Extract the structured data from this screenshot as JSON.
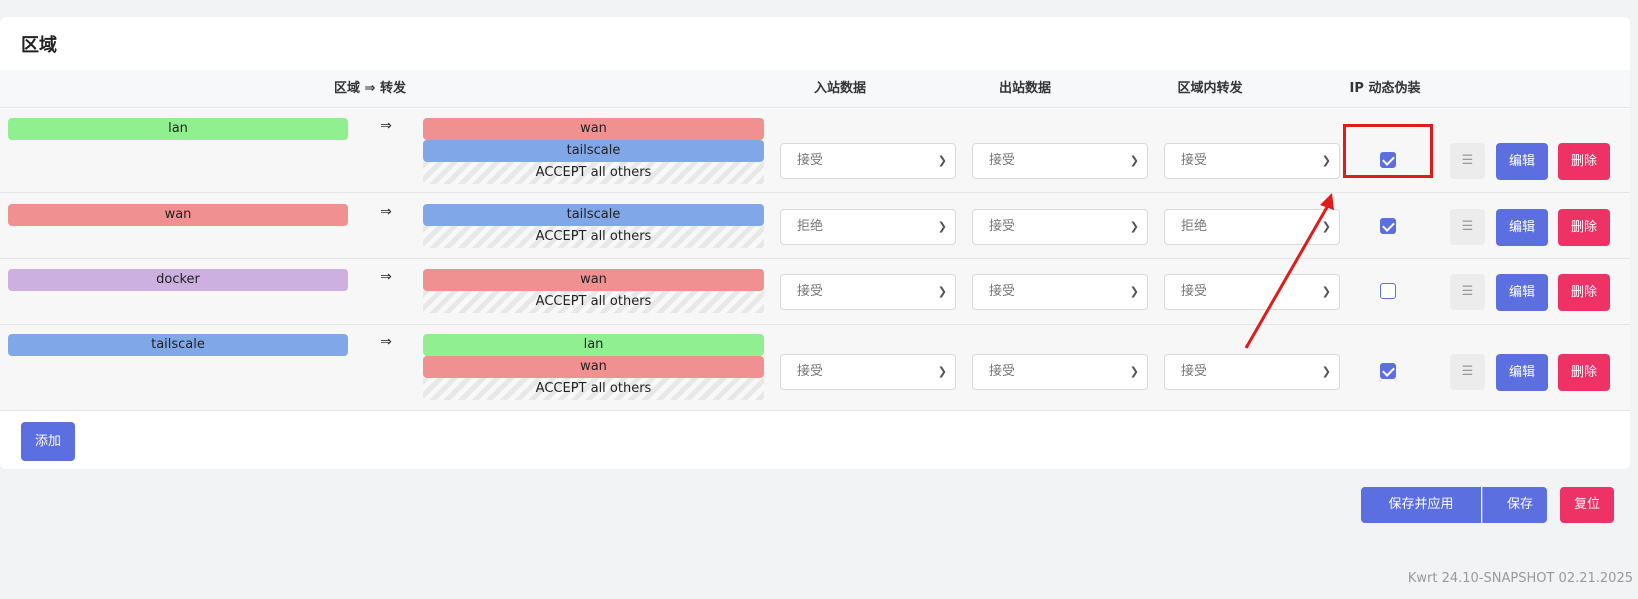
{
  "section": {
    "title": "区域"
  },
  "headers": {
    "zone_forward": "区域 ⇒ 转发",
    "inbound": "入站数据",
    "outbound": "出站数据",
    "intra_zone": "区域内转发",
    "masquerade": "IP 动态伪装"
  },
  "rows": [
    {
      "zone": "lan",
      "arrow": "⇒",
      "forwards": [
        "wan",
        "tailscale"
      ],
      "others": "ACCEPT all others",
      "inbound": "接受",
      "outbound": "接受",
      "intra": "接受",
      "masquerade": true,
      "handle": "☰",
      "edit": "编辑",
      "delete": "删除"
    },
    {
      "zone": "wan",
      "arrow": "⇒",
      "forwards": [
        "tailscale"
      ],
      "others": "ACCEPT all others",
      "inbound": "拒绝",
      "outbound": "接受",
      "intra": "拒绝",
      "masquerade": true,
      "handle": "☰",
      "edit": "编辑",
      "delete": "删除"
    },
    {
      "zone": "docker",
      "arrow": "⇒",
      "forwards": [
        "wan"
      ],
      "others": "ACCEPT all others",
      "inbound": "接受",
      "outbound": "接受",
      "intra": "接受",
      "masquerade": false,
      "handle": "☰",
      "edit": "编辑",
      "delete": "删除"
    },
    {
      "zone": "tailscale",
      "arrow": "⇒",
      "forwards": [
        "lan",
        "wan"
      ],
      "others": "ACCEPT all others",
      "inbound": "接受",
      "outbound": "接受",
      "intra": "接受",
      "masquerade": true,
      "handle": "☰",
      "edit": "编辑",
      "delete": "删除"
    }
  ],
  "add_button": "添加",
  "actions": {
    "save_apply": "保存并应用",
    "save_apply_dropdown": "▾",
    "save": "保存",
    "reset": "复位"
  },
  "footer": "Kwrt 24.10-SNAPSHOT 02.21.2025",
  "colors": {
    "primary": "#5b6fe0",
    "danger": "#ef3266",
    "zone_lan": "#90f090",
    "zone_wan": "#f09090",
    "zone_docker": "#cbb0e0",
    "zone_tailscale": "#80a8e8",
    "annotation": "#e01b1b"
  }
}
